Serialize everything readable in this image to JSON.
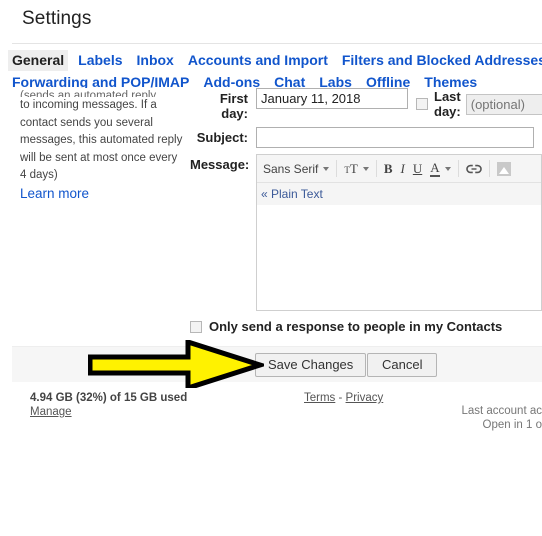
{
  "window": {
    "title": "Settings"
  },
  "tabs": {
    "row1": [
      {
        "label": "General",
        "active": true
      },
      {
        "label": "Labels",
        "active": false
      },
      {
        "label": "Inbox",
        "active": false
      },
      {
        "label": "Accounts and Import",
        "active": false
      },
      {
        "label": "Filters and Blocked Addresses",
        "active": false
      }
    ],
    "row2": [
      {
        "label": "Forwarding and POP/IMAP",
        "active": false
      },
      {
        "label": "Add-ons",
        "active": false
      },
      {
        "label": "Chat",
        "active": false
      },
      {
        "label": "Labs",
        "active": false
      },
      {
        "label": "Offline",
        "active": false
      },
      {
        "label": "Themes",
        "active": false
      }
    ]
  },
  "help": {
    "clipped_line": "(sends an automated reply",
    "paragraph": "to incoming messages. If a contact sends you several messages, this automated reply will be sent at most once every 4 days)",
    "learn_more": "Learn more"
  },
  "form": {
    "first_day": {
      "label": "First day:",
      "value": "January 11, 2018"
    },
    "last_day": {
      "checkbox_checked": false,
      "label": "Last day:",
      "placeholder": "(optional)",
      "value": "",
      "disabled": true
    },
    "subject": {
      "label": "Subject:",
      "value": "",
      "placeholder": ""
    },
    "message": {
      "label": "Message:",
      "value": "",
      "plain_text_link": "« Plain Text"
    },
    "toolbar": {
      "font_family": "Sans Serif",
      "items": [
        "font-family-dropdown",
        "font-size-dropdown",
        "bold-button",
        "italic-button",
        "underline-button",
        "text-color-dropdown",
        "insert-link-button",
        "insert-image-button"
      ]
    },
    "contacts_only": {
      "checked": false,
      "label": "Only send a response to people in my Contacts"
    }
  },
  "actions": {
    "save": "Save Changes",
    "cancel": "Cancel"
  },
  "footer": {
    "storage": "4.94 GB (32%) of 15 GB used",
    "manage": "Manage",
    "terms": "Terms",
    "separator": " - ",
    "privacy": "Privacy",
    "last_account_line1": "Last account ac",
    "last_account_line2": "Open in 1 o"
  },
  "annotation": {
    "type": "arrow",
    "points_to": "save-changes-button",
    "fill_color": "#FFF200",
    "stroke_color": "#000000"
  }
}
